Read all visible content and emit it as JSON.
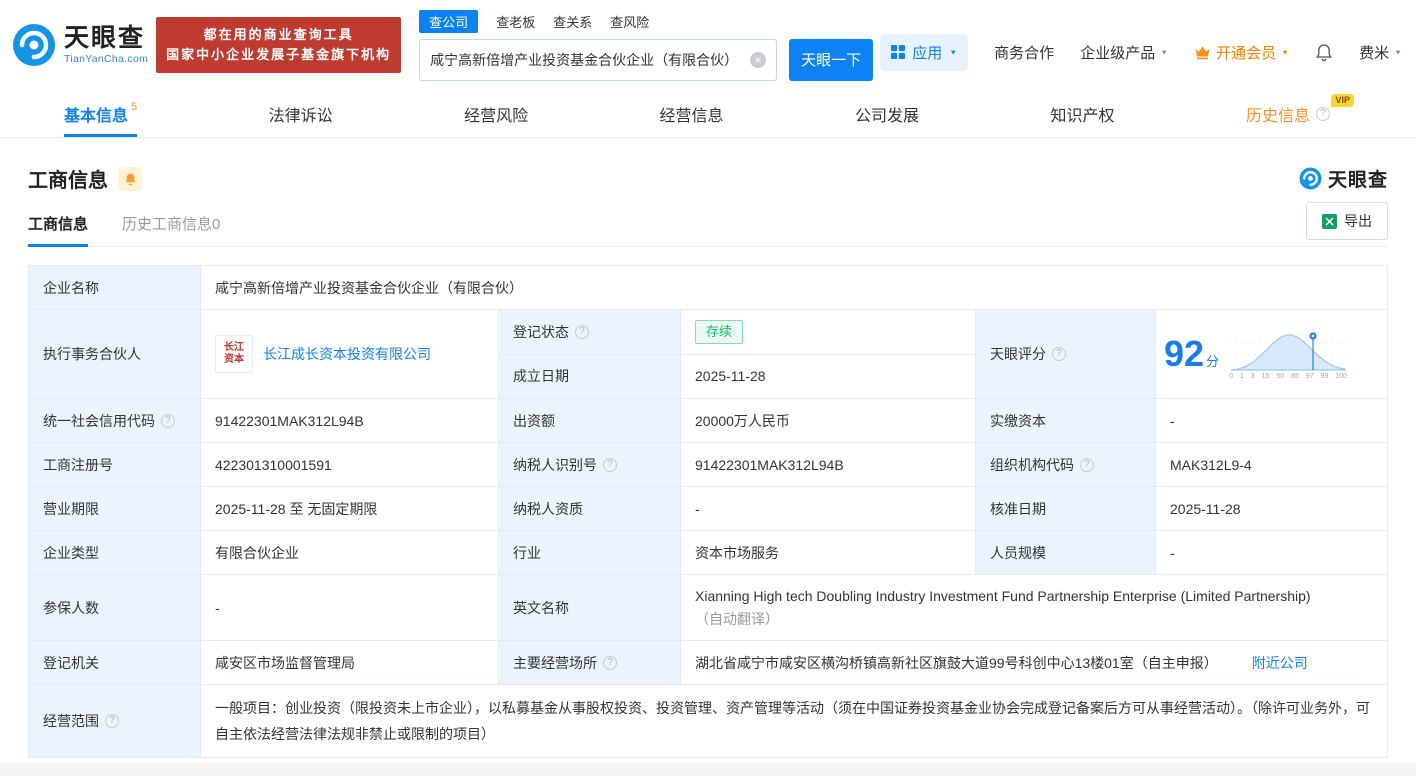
{
  "icons": {
    "question": "?",
    "caret": "▼",
    "close": "×"
  },
  "header": {
    "logo": {
      "name": "天眼查",
      "domain": "TianYanCha.com"
    },
    "banner": {
      "line1": "都在用的商业查询工具",
      "line2": "国家中小企业发展子基金旗下机构"
    },
    "search": {
      "tabs": [
        {
          "label": "查公司"
        },
        {
          "label": "查老板"
        },
        {
          "label": "查关系"
        },
        {
          "label": "查风险"
        }
      ],
      "value": "咸宁高新倍增产业投资基金合伙企业（有限合伙）",
      "button": "天眼一下"
    },
    "menu": {
      "apps": "应用",
      "cooperation": "商务合作",
      "enterprise": "企业级产品",
      "vip": "开通会员",
      "user": "费米"
    }
  },
  "nav": {
    "tabs": [
      {
        "label": "基本信息",
        "count": "5"
      },
      {
        "label": "法律诉讼"
      },
      {
        "label": "经营风险"
      },
      {
        "label": "经营信息"
      },
      {
        "label": "公司发展"
      },
      {
        "label": "知识产权"
      },
      {
        "label": "历史信息",
        "badge": "VIP"
      }
    ]
  },
  "section": {
    "title": "工商信息",
    "brand": "天眼查",
    "subtabs": [
      {
        "label": "工商信息"
      },
      {
        "label": "历史工商信息0"
      }
    ],
    "export": "导出"
  },
  "info": {
    "company_name": {
      "label": "企业名称",
      "value": "咸宁高新倍增产业投资基金合伙企业（有限合伙）"
    },
    "partner": {
      "label": "执行事务合伙人",
      "value": "长江成长资本投资有限公司",
      "logo_text": "长江资本"
    },
    "reg_status": {
      "label": "登记状态",
      "value": "存续"
    },
    "establish_date": {
      "label": "成立日期",
      "value": "2025-11-28"
    },
    "score": {
      "label": "天眼评分",
      "value": "92",
      "unit": "分",
      "axis": [
        "0",
        "1",
        "3",
        "15",
        "50",
        "85",
        "97",
        "99",
        "100"
      ]
    },
    "credit_code": {
      "label": "统一社会信用代码",
      "value": "91422301MAK312L94B"
    },
    "capital": {
      "label": "出资额",
      "value": "20000万人民币"
    },
    "paid_capital": {
      "label": "实缴资本",
      "value": "-"
    },
    "reg_number": {
      "label": "工商注册号",
      "value": "422301310001591"
    },
    "taxpayer_id": {
      "label": "纳税人识别号",
      "value": "91422301MAK312L94B"
    },
    "org_code": {
      "label": "组织机构代码",
      "value": "MAK312L9-4"
    },
    "business_term": {
      "label": "营业期限",
      "value": "2025-11-28 至 无固定期限"
    },
    "taxpayer_quality": {
      "label": "纳税人资质",
      "value": "-"
    },
    "approval_date": {
      "label": "核准日期",
      "value": "2025-11-28"
    },
    "company_type": {
      "label": "企业类型",
      "value": "有限合伙企业"
    },
    "industry": {
      "label": "行业",
      "value": "资本市场服务"
    },
    "staff_size": {
      "label": "人员规模",
      "value": "-"
    },
    "insured_count": {
      "label": "参保人数",
      "value": "-"
    },
    "english_name": {
      "label": "英文名称",
      "value": "Xianning High tech Doubling Industry Investment Fund Partnership Enterprise (Limited Partnership)",
      "note": "（自动翻译）"
    },
    "reg_authority": {
      "label": "登记机关",
      "value": "咸安区市场监督管理局"
    },
    "business_place": {
      "label": "主要经营场所",
      "value": "湖北省咸宁市咸安区横沟桥镇高新社区旗鼓大道99号科创中心13楼01室（自主申报）",
      "link": "附近公司"
    },
    "business_scope": {
      "label": "经营范围",
      "value": "一般项目：创业投资（限投资未上市企业），以私募基金从事股权投资、投资管理、资产管理等活动（须在中国证券投资基金业协会完成登记备案后方可从事经营活动）。（除许可业务外，可自主依法经营法律法规非禁止或限制的项目）"
    }
  }
}
